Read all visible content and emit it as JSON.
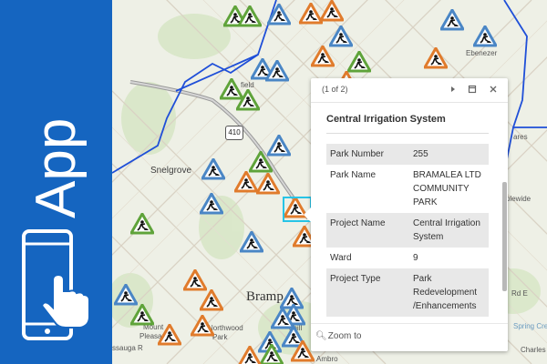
{
  "banner": {
    "app_label": "App",
    "phone_icon": "phone-tap-icon"
  },
  "map": {
    "labels": {
      "snelgrove": "Snelgrove",
      "brampton": "Bramp",
      "ebenezer": "Ebenezer",
      "field": "field",
      "mount_pleasant_1": "Mount",
      "mount_pleasant_2": "Pleasant",
      "northwood_1": "Northwood",
      "northwood_2": "Park",
      "highway": "410",
      "ares": "ares",
      "plewide": "plewide",
      "rd_e": "Rd E",
      "spring_creek": "Spring Cree",
      "charles": "Charles",
      "ambro": "Ambro",
      "ghill": "ghill",
      "sauga": "ssauga R"
    },
    "colors": {
      "completed": "#5fa33a",
      "in_progress": "#e07b2c",
      "planned": "#4a86c5",
      "boundary": "#1f4fd8",
      "selection": "#27c4e6"
    }
  },
  "popup": {
    "count": "(1 of 2)",
    "title": "Central Irrigation System",
    "rows": [
      {
        "key": "Park Number",
        "value": "255"
      },
      {
        "key": "Park Name",
        "value": "BRAMALEA LTD COMMUNITY PARK"
      },
      {
        "key": "Project Name",
        "value": "Central Irrigation System"
      },
      {
        "key": "Ward",
        "value": "9"
      },
      {
        "key": "Project Type",
        "value": "Park Redevelopment /Enhancements"
      }
    ],
    "zoom_label": "Zoom to",
    "next_icon": "play-next-icon",
    "maximize_icon": "maximize-icon",
    "close_icon": "close-icon"
  }
}
